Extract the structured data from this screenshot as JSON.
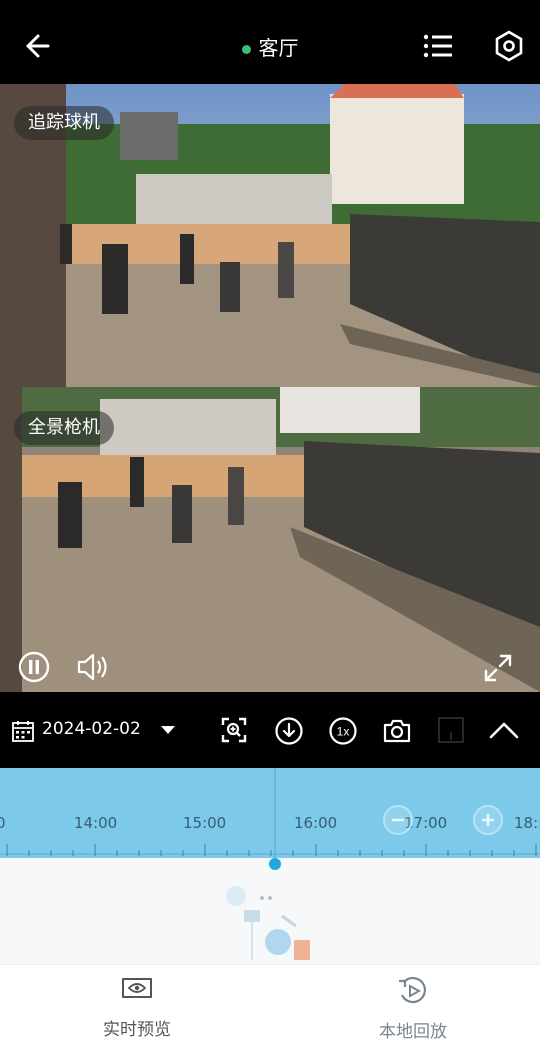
{
  "header": {
    "title": "客厅",
    "back_icon": "back-arrow-icon",
    "menu_icon": "list-icon",
    "settings_icon": "hexagon-settings-icon",
    "status_color": "#38c172"
  },
  "cameras": [
    {
      "label": "追踪球机"
    },
    {
      "label": "全景枪机"
    }
  ],
  "playback": {
    "pause_icon": "pause-icon",
    "volume_icon": "volume-icon",
    "fullscreen_icon": "fullscreen-icon"
  },
  "toolbar": {
    "date": "2024-02-02",
    "speed_label": "1x",
    "icons": [
      "calendar-icon",
      "dropdown-icon",
      "zoom-frame-icon",
      "download-icon",
      "speed-icon",
      "camera-icon",
      "record-icon",
      "chevron-up-icon"
    ]
  },
  "timeline": {
    "ticks": [
      "0",
      "14:00",
      "15:00",
      "16:00",
      "17:00",
      "18:"
    ],
    "zoom_out_icon": "zoom-out-icon",
    "zoom_in_icon": "zoom-in-icon",
    "accent": "#1ea7e1"
  },
  "bottom_nav": [
    {
      "label": "实时预览",
      "icon": "eye-icon",
      "active": false
    },
    {
      "label": "本地回放",
      "icon": "playback-icon",
      "active": true
    }
  ]
}
